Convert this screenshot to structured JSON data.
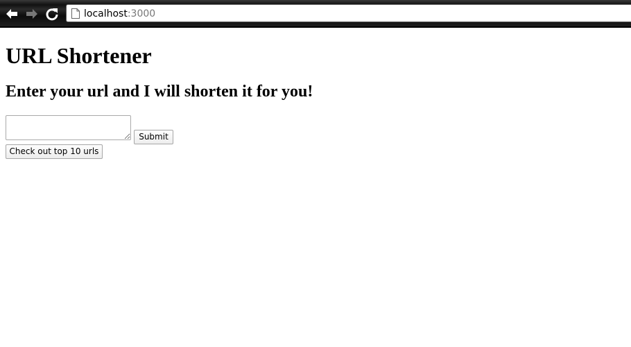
{
  "browser": {
    "url_host": "localhost",
    "url_port": ":3000"
  },
  "page": {
    "title": "URL Shortener",
    "subtitle": "Enter your url and I will shorten it for you!",
    "url_input_value": "",
    "submit_label": "Submit",
    "top_urls_label": "Check out top 10 urls"
  },
  "icons": {
    "back": "back-arrow-icon",
    "forward": "forward-arrow-icon",
    "reload": "reload-icon",
    "page": "page-icon"
  }
}
